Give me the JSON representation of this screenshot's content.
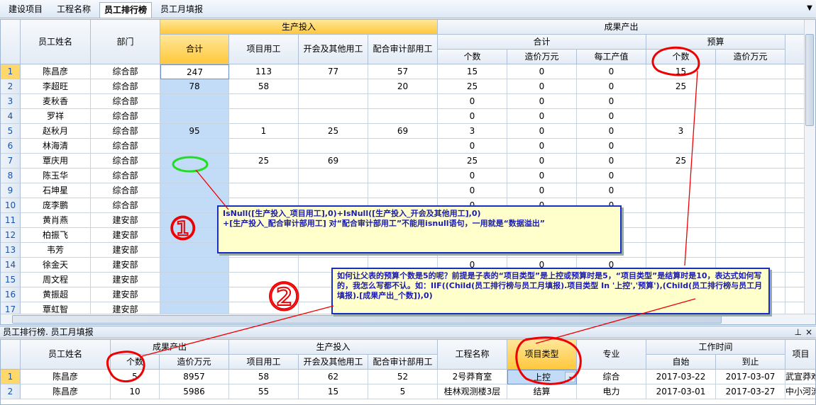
{
  "tabs": [
    {
      "label": "建设项目",
      "active": false
    },
    {
      "label": "工程名称",
      "active": false
    },
    {
      "label": "员工排行榜",
      "active": true
    },
    {
      "label": "员工月填报",
      "active": false
    }
  ],
  "main_grid": {
    "headers": {
      "name": "员工姓名",
      "dept": "部门",
      "production": "生产投入",
      "total": "合计",
      "project_labor": "项目用工",
      "meeting_labor": "开会及其他用工",
      "audit_labor": "配合审计部用工",
      "output": "成果产出",
      "output_total": "合计",
      "count": "个数",
      "cost": "造价万元",
      "per_labor": "每工产值",
      "budget": "预算",
      "budget_count": "个数",
      "budget_cost": "造价万元"
    },
    "rows": [
      {
        "no": "1",
        "name": "陈昌彦",
        "dept": "综合部",
        "total": "247",
        "proj": "113",
        "meet": "77",
        "audit": "57",
        "cnt": "15",
        "cost": "0",
        "per": "0",
        "bcnt": "15",
        "bcost": ""
      },
      {
        "no": "2",
        "name": "李超旺",
        "dept": "综合部",
        "total": "78",
        "proj": "58",
        "meet": "",
        "audit": "20",
        "cnt": "25",
        "cost": "0",
        "per": "0",
        "bcnt": "25",
        "bcost": ""
      },
      {
        "no": "3",
        "name": "麦秋香",
        "dept": "综合部",
        "total": "",
        "proj": "",
        "meet": "",
        "audit": "",
        "cnt": "0",
        "cost": "0",
        "per": "0",
        "bcnt": "",
        "bcost": ""
      },
      {
        "no": "4",
        "name": "罗祥",
        "dept": "综合部",
        "total": "",
        "proj": "",
        "meet": "",
        "audit": "",
        "cnt": "0",
        "cost": "0",
        "per": "0",
        "bcnt": "",
        "bcost": ""
      },
      {
        "no": "5",
        "name": "赵秋月",
        "dept": "综合部",
        "total": "95",
        "proj": "1",
        "meet": "25",
        "audit": "69",
        "cnt": "3",
        "cost": "0",
        "per": "0",
        "bcnt": "3",
        "bcost": ""
      },
      {
        "no": "6",
        "name": "林海清",
        "dept": "综合部",
        "total": "",
        "proj": "",
        "meet": "",
        "audit": "",
        "cnt": "0",
        "cost": "0",
        "per": "0",
        "bcnt": "",
        "bcost": ""
      },
      {
        "no": "7",
        "name": "覃庆用",
        "dept": "综合部",
        "total": "",
        "proj": "25",
        "meet": "69",
        "audit": "",
        "cnt": "25",
        "cost": "0",
        "per": "0",
        "bcnt": "25",
        "bcost": ""
      },
      {
        "no": "8",
        "name": "陈玉华",
        "dept": "综合部",
        "total": "",
        "proj": "",
        "meet": "",
        "audit": "",
        "cnt": "0",
        "cost": "0",
        "per": "0",
        "bcnt": "",
        "bcost": ""
      },
      {
        "no": "9",
        "name": "石坤星",
        "dept": "综合部",
        "total": "",
        "proj": "",
        "meet": "",
        "audit": "",
        "cnt": "0",
        "cost": "0",
        "per": "0",
        "bcnt": "",
        "bcost": ""
      },
      {
        "no": "10",
        "name": "庞李鹏",
        "dept": "综合部",
        "total": "",
        "proj": "",
        "meet": "",
        "audit": "",
        "cnt": "0",
        "cost": "0",
        "per": "0",
        "bcnt": "",
        "bcost": ""
      },
      {
        "no": "11",
        "name": "黄肖燕",
        "dept": "建安部",
        "total": "",
        "proj": "",
        "meet": "",
        "audit": "",
        "cnt": "",
        "cost": "",
        "per": "",
        "bcnt": "",
        "bcost": ""
      },
      {
        "no": "12",
        "name": "柏振飞",
        "dept": "建安部",
        "total": "",
        "proj": "",
        "meet": "",
        "audit": "",
        "cnt": "",
        "cost": "",
        "per": "",
        "bcnt": "",
        "bcost": ""
      },
      {
        "no": "13",
        "name": "韦芳",
        "dept": "建安部",
        "total": "",
        "proj": "",
        "meet": "",
        "audit": "",
        "cnt": "",
        "cost": "",
        "per": "",
        "bcnt": "",
        "bcost": ""
      },
      {
        "no": "14",
        "name": "徐金天",
        "dept": "建安部",
        "total": "",
        "proj": "",
        "meet": "",
        "audit": "",
        "cnt": "0",
        "cost": "0",
        "per": "0",
        "bcnt": "",
        "bcost": ""
      },
      {
        "no": "15",
        "name": "周文程",
        "dept": "建安部",
        "total": "",
        "proj": "",
        "meet": "",
        "audit": "",
        "cnt": "",
        "cost": "",
        "per": "",
        "bcnt": "",
        "bcost": ""
      },
      {
        "no": "16",
        "name": "黄振超",
        "dept": "建安部",
        "total": "",
        "proj": "",
        "meet": "",
        "audit": "",
        "cnt": "",
        "cost": "",
        "per": "",
        "bcnt": "",
        "bcost": ""
      },
      {
        "no": "17",
        "name": "覃虹智",
        "dept": "建安部",
        "total": "",
        "proj": "",
        "meet": "",
        "audit": "",
        "cnt": "",
        "cost": "",
        "per": "",
        "bcnt": "",
        "bcost": ""
      }
    ]
  },
  "detail_panel": {
    "title": "员工排行榜. 员工月填报",
    "pin_icon": "pin-icon",
    "close_icon": "close-icon",
    "headers": {
      "name": "员工姓名",
      "output": "成果产出",
      "count": "个数",
      "cost": "造价万元",
      "production": "生产投入",
      "project_labor": "项目用工",
      "meeting_labor": "开会及其他用工",
      "audit_labor": "配合审计部用工",
      "project_name": "工程名称",
      "project_type": "项目类型",
      "specialty": "专业",
      "work_time": "工作时间",
      "start": "自始",
      "end": "到止",
      "extra": "项目"
    },
    "rows": [
      {
        "no": "1",
        "name": "陈昌彦",
        "cnt": "5",
        "cost": "8957",
        "proj": "58",
        "meet": "62",
        "audit": "52",
        "pname": "2号莽育室",
        "ptype": "上控",
        "spec": "综合",
        "start": "2017-03-22",
        "end": "2017-03-07",
        "extra": "武宣莽难"
      },
      {
        "no": "2",
        "name": "陈昌彦",
        "cnt": "10",
        "cost": "5986",
        "proj": "55",
        "meet": "15",
        "audit": "5",
        "pname": "桂林观测楼3层",
        "ptype": "结算",
        "spec": "电力",
        "start": "2017-03-01",
        "end": "2017-03-27",
        "extra": "中小河流"
      }
    ]
  },
  "annotations": {
    "note1_line1": "IsNull([生产投入_项目用工],0)+IsNull([生产投入_开会及其他用工],0)",
    "note1_line2": "+[生产投入_配合审计部用工]      对“配合审计部用工”不能用isnull语句，一用就是“数据溢出”",
    "note2_text": "如何让父表的预算个数是5的呢？前提是子表的“项目类型”是上控或预算时是5，“项目类型”是结算时是10，表达式如何写的，我怎么写都不认。如：IIF((Child(员工排行榜与员工月填报).项目类型 In '上控','预算'),(Child(员工排行榜与员工月填报).[成果产出_个数]),0)",
    "circle1_label": "①",
    "circle2_label": "②"
  }
}
